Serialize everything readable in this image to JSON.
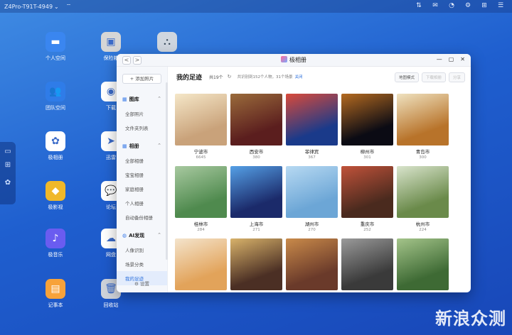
{
  "topbar": {
    "device": "Z4Pro-T91T-4949",
    "device_caret": "⌄"
  },
  "desktop": [
    {
      "label": "个人空间",
      "color": "#3a86f0",
      "glyph": "▬"
    },
    {
      "label": "团队空间",
      "color": "#2f7ce8",
      "glyph": "👥"
    },
    {
      "label": "极相册",
      "color": "#ffffff",
      "glyph": "✿"
    },
    {
      "label": "极影视",
      "color": "#f0b82a",
      "glyph": "◆"
    },
    {
      "label": "极音乐",
      "color": "#6a5cf0",
      "glyph": "♪"
    },
    {
      "label": "记事本",
      "color": "#f7a23a",
      "glyph": "▤"
    },
    {
      "label": "保险箱",
      "color": "#d6d6d6",
      "glyph": "▣"
    },
    {
      "label": "下载",
      "color": "#ffffff",
      "glyph": "◉"
    },
    {
      "label": "迅雷",
      "color": "#ffffff",
      "glyph": "➤"
    },
    {
      "label": "论坛",
      "color": "#ffffff",
      "glyph": "💬"
    },
    {
      "label": "网盘",
      "color": "#ffffff",
      "glyph": "☁"
    },
    {
      "label": "回收站",
      "color": "#cfd3da",
      "glyph": "🗑"
    }
  ],
  "window": {
    "title": "极相册",
    "back": "<",
    "forward": ">"
  },
  "sidebar": {
    "add_button": "+ 添加照片",
    "sections": [
      {
        "title": "图库",
        "items": [
          "全部照片",
          "文件夹列表"
        ]
      },
      {
        "title": "相册",
        "items": [
          "全部相册",
          "宝宝相册",
          "家庭相册",
          "个人相册",
          "自动备份相册"
        ]
      },
      {
        "title": "AI发现",
        "items": [
          "人像识别",
          "场景分类",
          "我的足迹"
        ]
      }
    ],
    "selected": "我的足迹",
    "settings": "⚙ 设置"
  },
  "main": {
    "title": "我的足迹",
    "count": "共19个",
    "refresh": "↻",
    "stats": "共识别到152个人物，31个场景",
    "link": "关闭",
    "btn_map": "地图模式",
    "btn_disabled": "下载相册",
    "btn_share": "分享"
  },
  "places": [
    {
      "name": "宁波市",
      "count": "6645",
      "c1": "#c9a27a",
      "c2": "#f5e7c8"
    },
    {
      "name": "西安市",
      "count": "380",
      "c1": "#5b1e1e",
      "c2": "#9a6b3b"
    },
    {
      "name": "菲律宾",
      "count": "367",
      "c1": "#1a3a8a",
      "c2": "#d94a3a"
    },
    {
      "name": "柳州市",
      "count": "301",
      "c1": "#0b0b14",
      "c2": "#b46a20"
    },
    {
      "name": "青岛市",
      "count": "300",
      "c1": "#b8732a",
      "c2": "#efe2c0"
    },
    {
      "name": "桂林市",
      "count": "284",
      "c1": "#4f8a4e",
      "c2": "#a8c9a0"
    },
    {
      "name": "上海市",
      "count": "271",
      "c1": "#1b2a6a",
      "c2": "#55a0e6"
    },
    {
      "name": "湖州市",
      "count": "270",
      "c1": "#6ca6d6",
      "c2": "#b7d9f2"
    },
    {
      "name": "重庆市",
      "count": "252",
      "c1": "#4a2a1e",
      "c2": "#c0523a"
    },
    {
      "name": "杭州市",
      "count": "224",
      "c1": "#6a8a4a",
      "c2": "#d9e4cc"
    },
    {
      "name": "",
      "count": "",
      "c1": "#e2a35a",
      "c2": "#f4e4cc"
    },
    {
      "name": "",
      "count": "",
      "c1": "#4b2f24",
      "c2": "#d8b26a"
    },
    {
      "name": "",
      "count": "",
      "c1": "#6a3a2a",
      "c2": "#c98a4a"
    },
    {
      "name": "",
      "count": "",
      "c1": "#3a3a3a",
      "c2": "#9a9a9a"
    },
    {
      "name": "",
      "count": "",
      "c1": "#3e6a34",
      "c2": "#a4c48a"
    }
  ],
  "watermark": "新浪众测"
}
